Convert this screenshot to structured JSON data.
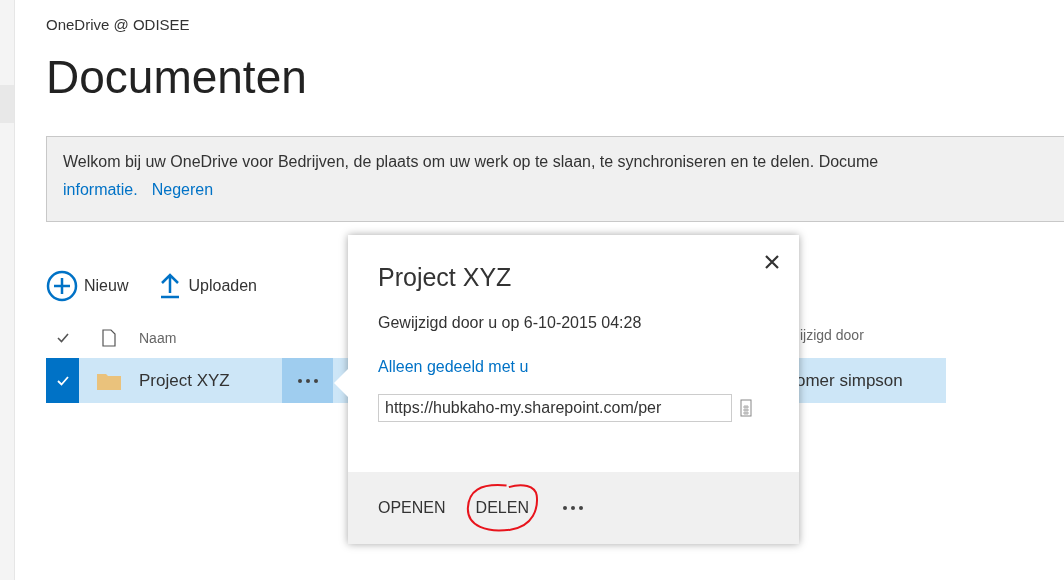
{
  "site": {
    "title": "OneDrive @ ODISEE"
  },
  "page_title": "Documenten",
  "banner": {
    "text": "Welkom bij uw OneDrive voor Bedrijven, de plaats om uw werk op te slaan, te synchroniseren en te delen. Docume",
    "links": [
      "informatie.",
      "Negeren"
    ]
  },
  "toolbar": [
    {
      "label": "Nieuw",
      "kind": "new"
    },
    {
      "label": "Uploaden",
      "kind": "upload"
    }
  ],
  "table": {
    "columns": [
      {
        "label": "Naam"
      },
      {
        "label": "ijzigd door"
      }
    ],
    "rows": [
      {
        "selected": true,
        "name": "Project XYZ",
        "modified_by": "omer simpson"
      }
    ]
  },
  "callout": {
    "title": "Project XYZ",
    "modified": "Gewijzigd door u op 6-10-2015 04:28",
    "sharing": "Alleen gedeeld met u",
    "url": "https://hubkaho-my.sharepoint.com/per",
    "actions": [
      {
        "label": "OPENEN",
        "circled": false
      },
      {
        "label": "DELEN",
        "circled": true
      }
    ]
  }
}
